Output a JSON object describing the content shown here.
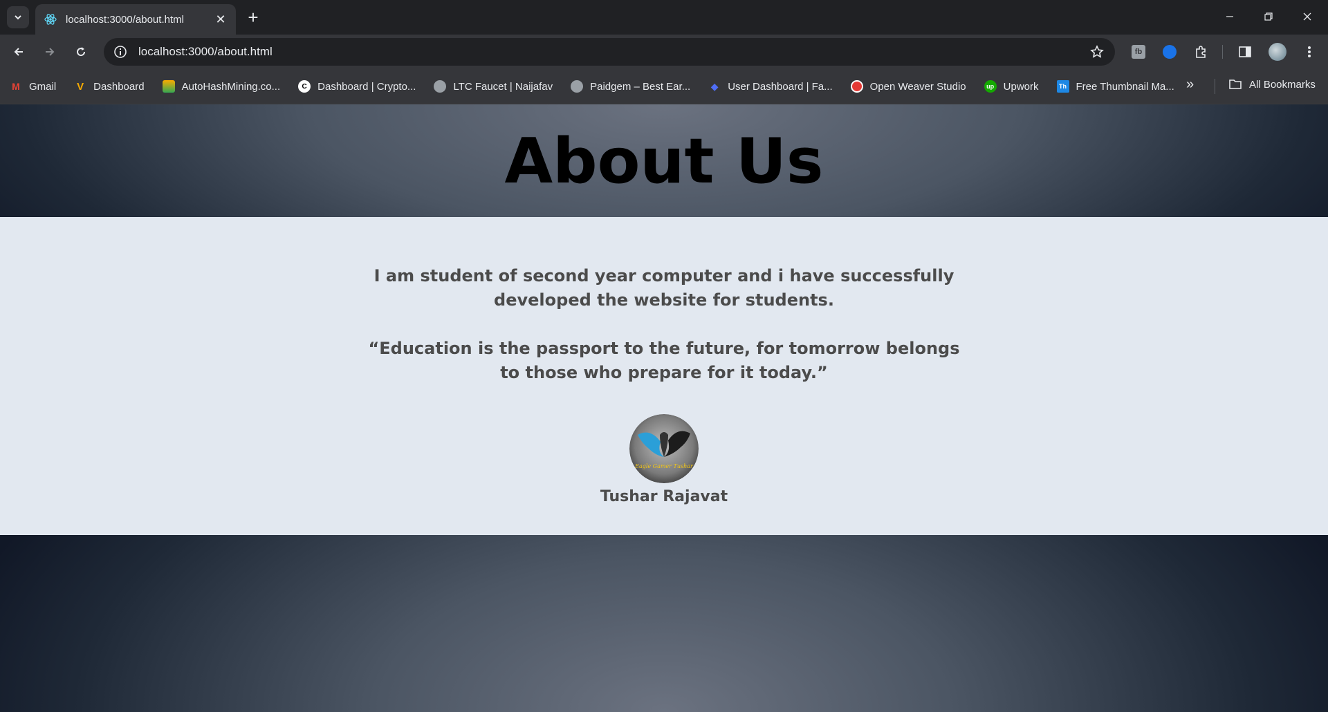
{
  "browser": {
    "tab_title": "localhost:3000/about.html",
    "url": "localhost:3000/about.html",
    "bookmarks": [
      {
        "label": "Gmail",
        "icon": "gmail-icon",
        "color": "#ea4335"
      },
      {
        "label": "Dashboard",
        "icon": "dashboard-icon",
        "color": "#f9ab00"
      },
      {
        "label": "AutoHashMining.co...",
        "icon": "autohash-icon",
        "color": "#34a853"
      },
      {
        "label": "Dashboard | Crypto...",
        "icon": "crypto-icon",
        "color": "#000000"
      },
      {
        "label": "LTC Faucet | Naijafav",
        "icon": "globe-icon",
        "color": "#9aa0a6"
      },
      {
        "label": "Paidgem – Best Ear...",
        "icon": "globe-icon",
        "color": "#9aa0a6"
      },
      {
        "label": "User Dashboard | Fa...",
        "icon": "diamond-icon",
        "color": "#4f6ef7"
      },
      {
        "label": "Open Weaver Studio",
        "icon": "openweaver-icon",
        "color": "#e53935"
      },
      {
        "label": "Upwork",
        "icon": "upwork-icon",
        "color": "#14a800"
      },
      {
        "label": "Free Thumbnail Ma...",
        "icon": "thumbnail-icon",
        "color": "#1e88e5"
      }
    ],
    "all_bookmarks_label": "All Bookmarks"
  },
  "page": {
    "title": "About Us",
    "intro": "I am student of second year computer and i have successfully developed the website for students.",
    "quote": "“Education is the passport to the future, for tomorrow belongs to those who prepare for it today.”",
    "author_name": "Tushar Rajavat",
    "avatar_text": "Eagle Gamer Tushar"
  }
}
